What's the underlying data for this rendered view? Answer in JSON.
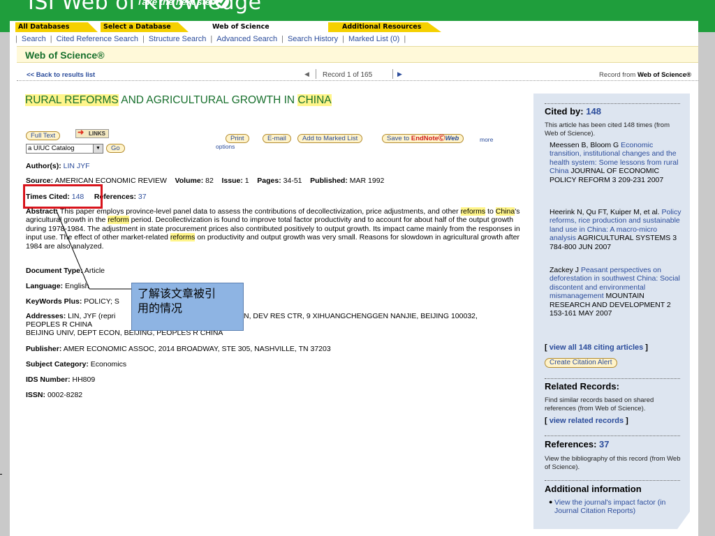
{
  "header": {
    "brand": "ISI Web of Knowledge",
    "tagline": "Take the next step"
  },
  "tabs": [
    {
      "label": "All Databases"
    },
    {
      "label": "Select a Database"
    },
    {
      "label": "Web of Science"
    },
    {
      "label": "Additional Resources"
    }
  ],
  "subnav": [
    {
      "label": "Search"
    },
    {
      "label": "Cited Reference Search"
    },
    {
      "label": "Structure Search"
    },
    {
      "label": "Advanced Search"
    },
    {
      "label": "Search History"
    },
    {
      "label": "Marked List (0)"
    }
  ],
  "section_title": "Web of Science®",
  "record_nav": {
    "back": "<< Back to results list",
    "count": "Record 1 of 165",
    "source_prefix": "Record from ",
    "source_name": "Web of Science®"
  },
  "article": {
    "title_parts": [
      "RURAL REFORMS",
      " AND AGRICULTURAL GROWTH IN ",
      "CHINA"
    ]
  },
  "actions": {
    "full_text": "Full Text",
    "links": "LINKS",
    "catalog": "a UIUC Catalog",
    "go": "Go",
    "print": "Print",
    "email": "E-mail",
    "add_marked": "Add to Marked List",
    "save_to": "Save to",
    "endnote": "EndNote",
    "endnote_web": "Web",
    "more": "more",
    "options": "options"
  },
  "fields": {
    "authors_label": "Author(s):",
    "authors_value": "LIN JYF",
    "source_label": "Source:",
    "source_value": "AMERICAN ECONOMIC REVIEW",
    "volume_label": "Volume:",
    "volume_value": "82",
    "issue_label": "Issue:",
    "issue_value": "1",
    "pages_label": "Pages:",
    "pages_value": "34-51",
    "published_label": "Published:",
    "published_value": "MAR 1992",
    "times_cited_label": "Times Cited:",
    "times_cited_value": "148",
    "references_label": "References:",
    "references_value": "37",
    "abstract_label": "Abstract:",
    "abstract_1": " This paper employs province-level panel data to assess the contributions of decollectivization, price adjustments, and other ",
    "abstract_hl1": "reforms",
    "abstract_2": " to ",
    "abstract_hl2": "China",
    "abstract_3": "'s agricultural growth in the ",
    "abstract_hl3": "reform",
    "abstract_4": " period. Decollectivization is found to improve total factor productivity and to account for about half of the output growth during 1978-1984. The adjustment in state procurement prices also contributed positively to output growth. Its impact came mainly from the responses in input use. The effect of other market-related ",
    "abstract_hl4": "reforms",
    "abstract_5": " on productivity and output growth was very small. Reasons for slowdown in agricultural growth after 1984 are also analyzed.",
    "doctype_label": "Document Type:",
    "doctype_value": "Article",
    "language_label": "Language:",
    "language_value": "English",
    "keywords_label": "KeyWords Plus:",
    "keywords_value": "POLICY; S",
    "addresses_label": "Addresses:",
    "addresses_value_a": "LIN, JYF (repri",
    "addresses_value_b": "N, DEV RES CTR, 9 XIHUANGCHENGGEN NANJIE, BEIJING 100032,",
    "addresses_line2": "PEOPLES R CHINA",
    "addresses_line3": "BEIJING UNIV, DEPT ECON, BEIJING, PEOPLES R CHINA",
    "publisher_label": "Publisher:",
    "publisher_value": "AMER ECONOMIC ASSOC, 2014 BROADWAY, STE 305, NASHVILLE, TN 37203",
    "subject_label": "Subject Category:",
    "subject_value": "Economics",
    "ids_label": "IDS Number:",
    "ids_value": "HH809",
    "issn_label": "ISSN:",
    "issn_value": "0002-8282"
  },
  "callout": {
    "line1": "了解该文章被引",
    "line2": "用的情况"
  },
  "sidebar": {
    "cited_by_label": "Cited by: ",
    "cited_by_count": "148",
    "cited_by_desc": "This article has been cited 148 times (from Web of Science).",
    "citations": [
      {
        "authors": "Meessen B, Bloom G ",
        "title": "Economic transition, institutional changes and the health system: Some lessons from rural China",
        "rest": " JOURNAL OF ECONOMIC POLICY REFORM 3 209-231 2007"
      },
      {
        "authors": "Heerink N, Qu FT, Kuiper M, et al. ",
        "title": "Policy reforms, rice production and sustainable land use in China: A macro-micro analysis",
        "rest": " AGRICULTURAL SYSTEMS 3 784-800 JUN 2007"
      },
      {
        "authors": "Zackey J ",
        "title": "Peasant perspectives on deforestation in southwest China: Social discontent and environmental mismanagement",
        "rest": " MOUNTAIN RESEARCH AND DEVELOPMENT 2 153-161 MAY 2007"
      }
    ],
    "view_all": "view all 148 citing articles",
    "create_alert": "Create Citation Alert",
    "related_label": "Related Records:",
    "related_desc": "Find similar records based on shared references (from Web of Science).",
    "view_related": "view related records",
    "references_label": "References: ",
    "references_count": "37",
    "references_desc": "View the bibliography of this record (from Web of Science).",
    "additional_label": "Additional information",
    "additional_item": "View the journal's impact factor (in Journal Citation Reports)"
  }
}
